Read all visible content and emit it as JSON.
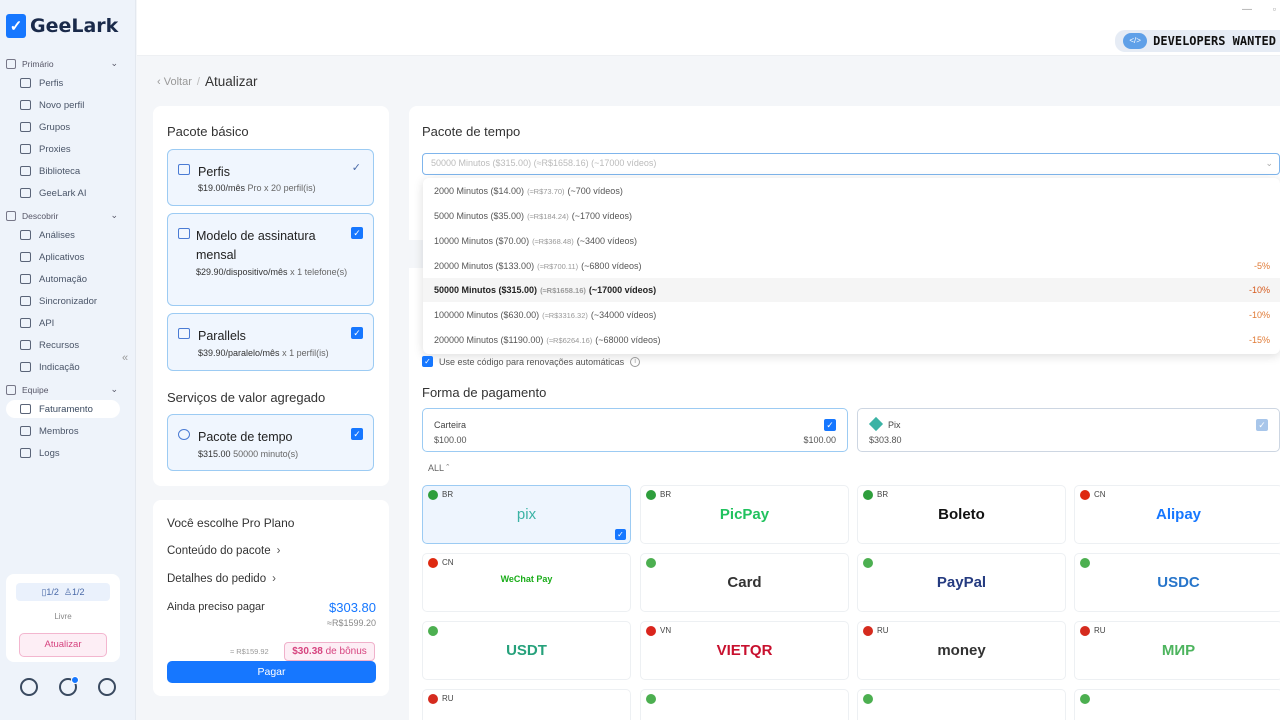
{
  "app": {
    "name": "GeeLark"
  },
  "sidebar": {
    "sections": [
      {
        "label": "Primário",
        "items": [
          {
            "label": "Perfis"
          },
          {
            "label": "Novo perfil"
          },
          {
            "label": "Grupos"
          },
          {
            "label": "Proxies"
          },
          {
            "label": "Biblioteca"
          },
          {
            "label": "GeeLark AI"
          }
        ]
      },
      {
        "label": "Descobrir",
        "items": [
          {
            "label": "Análises"
          },
          {
            "label": "Aplicativos"
          },
          {
            "label": "Automação"
          },
          {
            "label": "Sincronizador"
          },
          {
            "label": "API"
          },
          {
            "label": "Recursos"
          },
          {
            "label": "Indicação"
          }
        ]
      },
      {
        "label": "Equipe",
        "items": [
          {
            "label": "Faturamento"
          },
          {
            "label": "Membros"
          },
          {
            "label": "Logs"
          }
        ]
      }
    ],
    "quota": {
      "profiles": "1/2",
      "members": "1/2",
      "status": "Livre"
    },
    "upgrade_label": "Atualizar"
  },
  "topbar": {
    "banner": "DEVELOPERS WANTED",
    "banner_logo": "</>"
  },
  "breadcrumb": {
    "back": "Voltar",
    "separator": "/",
    "current": "Atualizar"
  },
  "basic_package": {
    "title": "Pacote básico",
    "cards": [
      {
        "name": "Perfis",
        "price": "$19.00/mês",
        "detail": "Pro x 20 perfil(is)"
      },
      {
        "name": "Modelo de assinatura mensal",
        "price": "$29.90/dispositivo/mês",
        "detail": "x 1 telefone(s)"
      },
      {
        "name": "Parallels",
        "price": "$39.90/paralelo/mês",
        "detail": "x 1 perfil(is)"
      }
    ]
  },
  "value_added": {
    "title": "Serviços de valor agregado",
    "card": {
      "name": "Pacote de tempo",
      "price": "$315.00",
      "detail": "50000 minuto(s)"
    }
  },
  "summary": {
    "title": "Você escolhe Pro Plano",
    "package_content": "Conteúdo do pacote",
    "order_details": "Detalhes do pedido",
    "still_to_pay_label": "Ainda preciso pagar",
    "still_to_pay": "$303.80",
    "still_to_pay_brl": "≈R$1599.20",
    "bonus_brl": "≈ R$159.92",
    "bonus_amount": "$30.38",
    "bonus_label": "de bônus",
    "pay_label": "Pagar"
  },
  "time_package": {
    "title": "Pacote de tempo",
    "select": {
      "minutes": "50000 Minutos ($315.00)",
      "brl": "(≈R$1658.16)",
      "videos": "(~17000 vídeos)"
    },
    "options": [
      {
        "minutes": "2000 Minutos ($14.00)",
        "brl": "(≈R$73.70)",
        "videos": "(~700 vídeos)",
        "discount": ""
      },
      {
        "minutes": "5000 Minutos ($35.00)",
        "brl": "(≈R$184.24)",
        "videos": "(~1700 vídeos)",
        "discount": ""
      },
      {
        "minutes": "10000 Minutos ($70.00)",
        "brl": "(≈R$368.48)",
        "videos": "(~3400 vídeos)",
        "discount": ""
      },
      {
        "minutes": "20000 Minutos ($133.00)",
        "brl": "(≈R$700.11)",
        "videos": "(~6800 vídeos)",
        "discount": "-5%"
      },
      {
        "minutes": "50000 Minutos ($315.00)",
        "brl": "(≈R$1658.16)",
        "videos": "(~17000 vídeos)",
        "discount": "-10%"
      },
      {
        "minutes": "100000 Minutos ($630.00)",
        "brl": "(≈R$3316.32)",
        "videos": "(~34000 vídeos)",
        "discount": "-10%"
      },
      {
        "minutes": "200000 Minutos ($1190.00)",
        "brl": "(≈R$6264.16)",
        "videos": "(~68000 vídeos)",
        "discount": "-15%"
      }
    ],
    "selected_index": 4,
    "renew_label": "Use este código para renovações automáticas"
  },
  "payment": {
    "title": "Forma de pagamento",
    "wallet": {
      "label": "Carteira",
      "value": "$100.00",
      "value_right": "$100.00"
    },
    "pix": {
      "label": "Pix",
      "value": "$303.80"
    },
    "all_label": "ALL",
    "methods": [
      {
        "code": "BR",
        "name": "pix",
        "color": "#3bb3a5",
        "flag": "#2e9e3c",
        "selected": true
      },
      {
        "code": "BR",
        "name": "PicPay",
        "color": "#21c25e",
        "flag": "#2e9e3c"
      },
      {
        "code": "BR",
        "name": "Boleto",
        "color": "#111111",
        "flag": "#2e9e3c"
      },
      {
        "code": "CN",
        "name": "Alipay",
        "color": "#1677ff",
        "flag": "#de2910"
      },
      {
        "code": "CN",
        "name": "WeChat Pay",
        "color": "#1aad19",
        "flag": "#de2910"
      },
      {
        "code": "",
        "name": "Card",
        "color": "#333333",
        "flag": "#4caf50"
      },
      {
        "code": "",
        "name": "PayPal",
        "color": "#253b80",
        "flag": "#4caf50"
      },
      {
        "code": "",
        "name": "USDC",
        "color": "#2775ca",
        "flag": "#4caf50"
      },
      {
        "code": "",
        "name": "USDT",
        "color": "#26a17b",
        "flag": "#4caf50"
      },
      {
        "code": "VN",
        "name": "VIETQR",
        "color": "#c8102e",
        "flag": "#da251d"
      },
      {
        "code": "RU",
        "name": "money",
        "color": "#333333",
        "flag": "#d52b1e"
      },
      {
        "code": "RU",
        "name": "МИР",
        "color": "#4db45e",
        "flag": "#d52b1e"
      },
      {
        "code": "RU",
        "name": "",
        "color": "#333333",
        "flag": "#d52b1e"
      },
      {
        "code": "",
        "name": "",
        "color": "#333333",
        "flag": "#4caf50"
      },
      {
        "code": "",
        "name": "",
        "color": "#333333",
        "flag": "#4caf50"
      },
      {
        "code": "",
        "name": "",
        "color": "#333333",
        "flag": "#4caf50"
      }
    ]
  }
}
